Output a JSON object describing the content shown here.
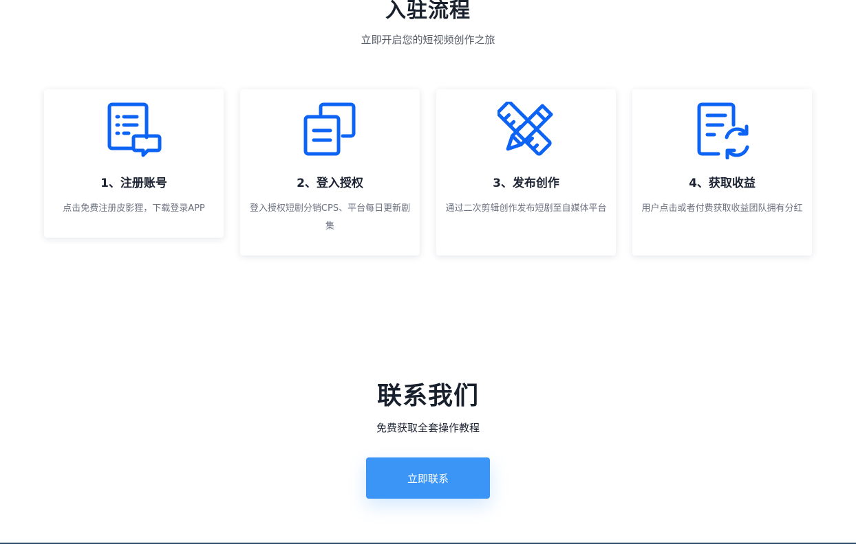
{
  "process": {
    "title": "入驻流程",
    "subtitle": "立即开启您的短视频创作之旅",
    "steps": [
      {
        "icon": "list-chat-icon",
        "title": "1、注册账号",
        "desc": "点击免费注册皮影狸，下载登录APP"
      },
      {
        "icon": "copy-document-icon",
        "title": "2、登入授权",
        "desc": "登入授权短剧分销CPS、平台每日更新剧集"
      },
      {
        "icon": "pencil-ruler-icon",
        "title": "3、发布创作",
        "desc": "通过二次剪辑创作发布短剧至自媒体平台"
      },
      {
        "icon": "document-refresh-icon",
        "title": "4、获取收益",
        "desc": "用户点击或者付费获取收益团队拥有分红"
      }
    ]
  },
  "contact": {
    "title": "联系我们",
    "subtitle": "免费获取全套操作教程",
    "button_label": "立即联系"
  },
  "colors": {
    "accent": "#0d63f3",
    "button": "#3b95f6",
    "heading": "#18202d",
    "muted": "#6b7280"
  }
}
